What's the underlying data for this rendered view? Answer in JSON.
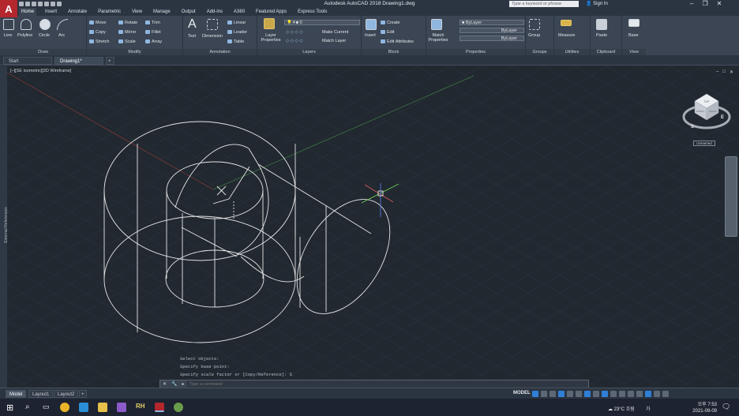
{
  "app": {
    "title": "Autodesk AutoCAD 2018    Drawing1.dwg",
    "search_placeholder": "Type a keyword or phrase",
    "sign_in": "Sign In",
    "logo_letter": "A"
  },
  "menu_tabs": [
    "Home",
    "Insert",
    "Annotate",
    "Parametric",
    "View",
    "Manage",
    "Output",
    "Add-ins",
    "A360",
    "Featured Apps",
    "Express Tools"
  ],
  "ribbon": {
    "draw": {
      "title": "Draw",
      "line": "Line",
      "polyline": "Polyline",
      "circle": "Circle",
      "arc": "Arc"
    },
    "modify": {
      "title": "Modify",
      "move": "Move",
      "rotate": "Rotate",
      "trim": "Trim",
      "copy": "Copy",
      "mirror": "Mirror",
      "fillet": "Fillet",
      "stretch": "Stretch",
      "scale": "Scale",
      "array": "Array"
    },
    "annotation": {
      "title": "Annotation",
      "text": "Text",
      "dimension": "Dimension",
      "linear": "Linear",
      "leader": "Leader",
      "table": "Table"
    },
    "layers": {
      "title": "Layers",
      "layer_properties": "Layer Properties",
      "current_layer": "0",
      "make_current": "Make Current",
      "match_layer": "Match Layer"
    },
    "block": {
      "title": "Block",
      "insert": "Insert",
      "create": "Create",
      "edit": "Edit",
      "edit_attributes": "Edit Attributes"
    },
    "properties": {
      "title": "Properties",
      "match_properties": "Match Properties",
      "bylayer": "ByLayer"
    },
    "groups": {
      "title": "Groups",
      "group": "Group"
    },
    "utilities": {
      "title": "Utilities",
      "measure": "Measure"
    },
    "clipboard": {
      "title": "Clipboard",
      "paste": "Paste"
    },
    "view": {
      "title": "View",
      "base": "Base"
    }
  },
  "file_tabs": {
    "start": "Start",
    "drawing": "Drawing1*"
  },
  "viewport": {
    "label": "[–][SE Isometric][2D Wireframe]",
    "external_references": "External References",
    "named_view": "Unnamed",
    "viewcube_faces": {
      "top": "TOP",
      "front": "FRONT",
      "right": "RIGHT"
    },
    "compass": {
      "n": "N",
      "w": "W",
      "e": "E",
      "s": "S"
    }
  },
  "command": {
    "history": [
      "Select objects:",
      "Specify base point:",
      "Specify scale factor or [Copy/Reference]: 5"
    ],
    "placeholder": "Type a command"
  },
  "layout_tabs": [
    "Model",
    "Layout1",
    "Layout2"
  ],
  "status": {
    "model": "MODEL"
  },
  "taskbar": {
    "temperature": "23°C 흐림",
    "ime": "가",
    "clock_time": "오후 7:53",
    "clock_date": "2021-09-09"
  },
  "colors": {
    "canvas": "#212830",
    "ribbon": "#3b4553",
    "accent": "#2f7fd6",
    "brand": "#b3272d",
    "geometry": "#e6e6e6"
  }
}
